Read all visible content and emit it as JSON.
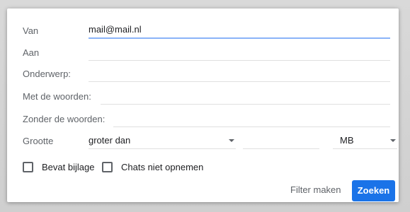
{
  "form": {
    "from": {
      "label": "Van",
      "value": "mail@mail.nl"
    },
    "to": {
      "label": "Aan",
      "value": ""
    },
    "subject": {
      "label": "Onderwerp:",
      "value": ""
    },
    "has_words": {
      "label": "Met de woorden:",
      "value": ""
    },
    "without_words": {
      "label": "Zonder de woorden:",
      "value": ""
    },
    "size": {
      "label": "Grootte",
      "comparator": "groter dan",
      "amount": "",
      "unit": "MB"
    }
  },
  "checkboxes": [
    {
      "label": "Bevat bijlage",
      "checked": false
    },
    {
      "label": "Chats niet opnemen",
      "checked": false
    }
  ],
  "actions": {
    "create_filter": "Filter maken",
    "search": "Zoeken"
  },
  "colors": {
    "primary_button": "#1a73e8",
    "focus_underline": "#8ab4f8"
  }
}
